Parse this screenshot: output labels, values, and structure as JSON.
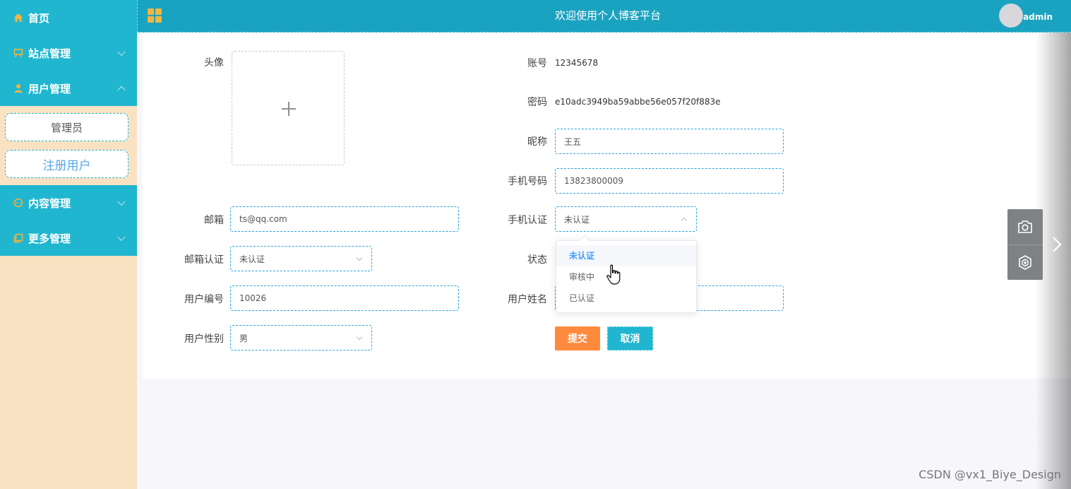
{
  "header": {
    "title": "欢迎使用个人博客平台",
    "username": "admin"
  },
  "sidebar": {
    "items": [
      {
        "label": "首页",
        "icon": "home-icon"
      },
      {
        "label": "站点管理",
        "icon": "easel-icon"
      },
      {
        "label": "用户管理",
        "icon": "user-icon"
      },
      {
        "label": "内容管理",
        "icon": "chat-icon"
      },
      {
        "label": "更多管理",
        "icon": "copy-icon"
      }
    ],
    "user_submenu": [
      "管理员",
      "注册用户"
    ]
  },
  "form": {
    "avatar_label": "头像",
    "account_label": "账号",
    "account_value": "12345678",
    "password_label": "密码",
    "password_value": "e10adc3949ba59abbe56e057f20f883e",
    "nickname_label": "昵称",
    "nickname_value": "王五",
    "phone_label": "手机号码",
    "phone_value": "13823800009",
    "email_label": "邮箱",
    "email_value": "ts@qq.com",
    "phone_verify_label": "手机认证",
    "phone_verify_value": "未认证",
    "email_verify_label": "邮箱认证",
    "email_verify_value": "未认证",
    "status_label": "状态",
    "user_no_label": "用户编号",
    "user_no_value": "10026",
    "real_name_label": "用户姓名",
    "real_name_value": "",
    "gender_label": "用户性别",
    "gender_value": "男",
    "submit_label": "提交",
    "cancel_label": "取消"
  },
  "dropdown": {
    "options": [
      "未认证",
      "审核中",
      "已认证"
    ],
    "selected": "未认证"
  },
  "watermark": "CSDN @vx1_Biye_Design",
  "colors": {
    "sidebar_menu": "#21b6cf",
    "header": "#1aa3c0",
    "submit": "#ff8a3d",
    "sidebar_bg": "#f9e2c1"
  }
}
